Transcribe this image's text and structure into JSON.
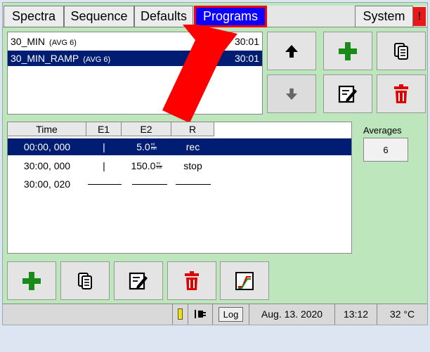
{
  "tabs": [
    {
      "label": "Spectra"
    },
    {
      "label": "Sequence"
    },
    {
      "label": "Defaults"
    },
    {
      "label": "Programs",
      "active": true
    },
    {
      "label": "System"
    }
  ],
  "warning": {
    "label": "!"
  },
  "programs": [
    {
      "name": "30_MIN",
      "avg": "(AVG 6)",
      "duration": "30:01",
      "selected": false
    },
    {
      "name": "30_MIN_RAMP",
      "avg": "(AVG 6)",
      "duration": "30:01",
      "selected": true
    }
  ],
  "program_buttons": [
    "up-arrow-icon",
    "add-icon",
    "copy-icon",
    "down-arrow-icon",
    "edit-icon",
    "delete-icon"
  ],
  "step_table": {
    "headers": [
      "Time",
      "E1",
      "E2",
      "R"
    ],
    "rows": [
      {
        "time": "00:00, 000",
        "e1": "|",
        "e2": "5.0",
        "e2_unit_top": "ml",
        "e2_unit_bottom": "min",
        "r": "rec",
        "selected": true
      },
      {
        "time": "30:00, 000",
        "e1": "|",
        "e2": "150.0",
        "e2_unit_top": "ml",
        "e2_unit_bottom": "min",
        "r": "stop",
        "selected": false
      },
      {
        "time": "30:00, 020",
        "e1": "",
        "e2": "",
        "r": "",
        "selected": false
      }
    ]
  },
  "averages": {
    "label": "Averages",
    "value": "6"
  },
  "bottom_buttons": [
    "add-icon",
    "copy-icon",
    "edit-icon",
    "delete-icon",
    "ramp-chart-icon"
  ],
  "status": {
    "log": "Log",
    "date": "Aug. 13. 2020",
    "time": "13:12",
    "temperature": "32 °C"
  },
  "colors": {
    "selected": "#001d73",
    "tab_active": "#0b00ff",
    "highlight": "#ff0000",
    "add": "#1a8a1a",
    "delete": "#e00000",
    "panel": "#bde6bd"
  }
}
